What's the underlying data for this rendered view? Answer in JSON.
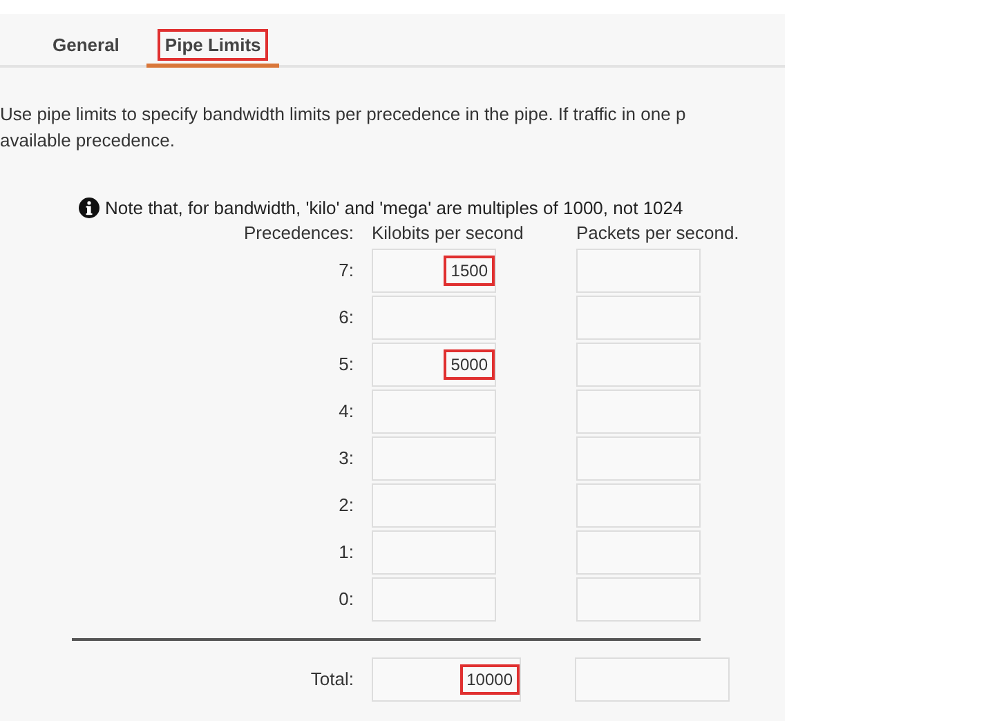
{
  "tabs": [
    {
      "label": "General",
      "selected": false,
      "highlighted": false
    },
    {
      "label": "Pipe Limits",
      "selected": true,
      "highlighted": true
    }
  ],
  "description": [
    "Use pipe limits to specify bandwidth limits per precedence in the pipe. If traffic in one p",
    "available precedence."
  ],
  "note": "Note that, for bandwidth, 'kilo' and 'mega' are multiples of 1000, not 1024",
  "headers": {
    "precedences": "Precedences:",
    "kbps": "Kilobits per second",
    "pps": "Packets per second."
  },
  "rows": [
    {
      "label": "7:",
      "kbps": {
        "value": "1500",
        "highlighted": true
      }
    },
    {
      "label": "6:"
    },
    {
      "label": "5:",
      "kbps": {
        "value": "5000",
        "highlighted": true
      }
    },
    {
      "label": "4:"
    },
    {
      "label": "3:"
    },
    {
      "label": "2:"
    },
    {
      "label": "1:"
    },
    {
      "label": "0:"
    }
  ],
  "total": {
    "label": "Total:",
    "kbps": {
      "value": "10000",
      "highlighted": true
    }
  }
}
